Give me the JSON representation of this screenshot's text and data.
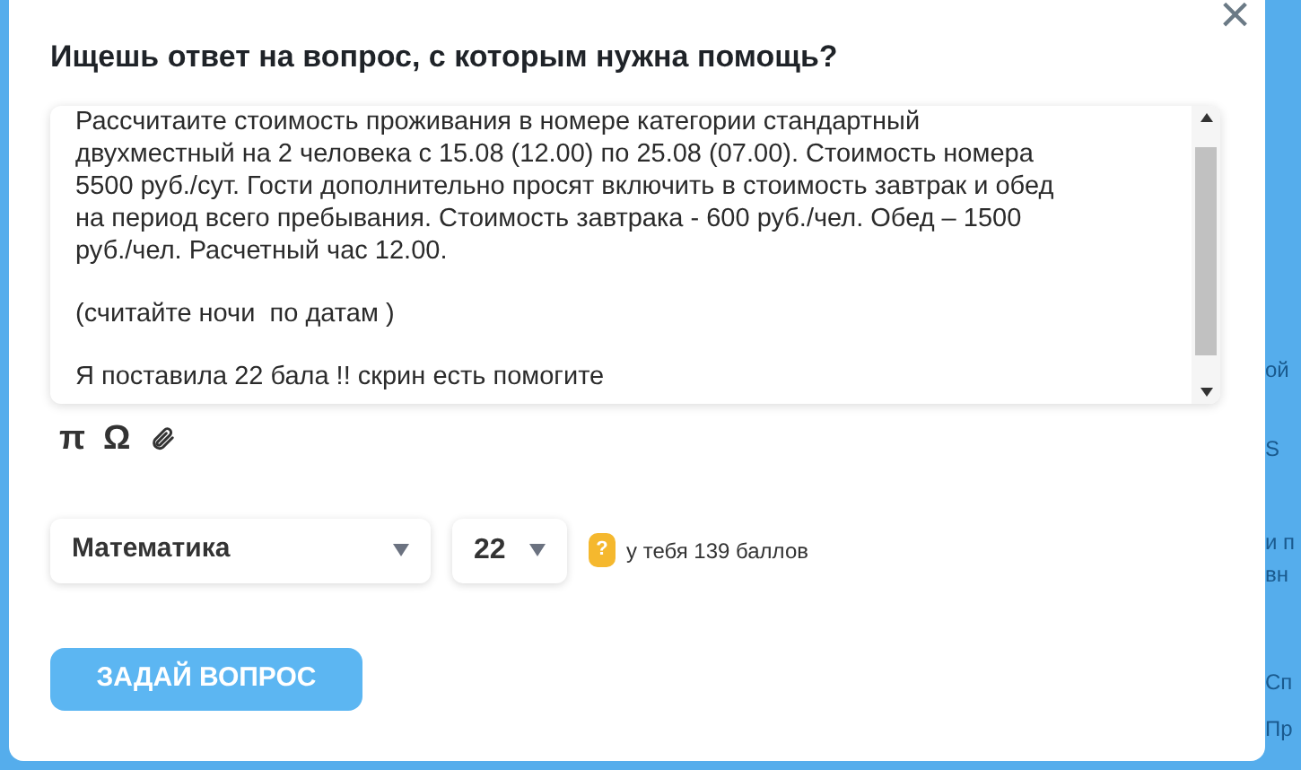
{
  "dialog": {
    "title": "Ищешь ответ на вопрос, с которым нужна помощь?",
    "close": "×"
  },
  "question_field": {
    "paragraphs": [
      [
        "Рассчитаите стоимость проживания в номере категории стандартный",
        "двухместный на 2 человека с 15.08 (12.00) по 25.08 (07.00). Стоимость номера",
        "5500 руб./сут. Гости дополнительно просят включить в стоимость завтрак и обед",
        "на период всего пребывания. Стоимость завтрака - 600 руб./чел. Обед – 1500",
        "руб./чел. Расчетный час 12.00."
      ],
      [
        "(считайте ночи  по датам )"
      ],
      [
        "Я поставила 22 бала !! скрин есть помогите"
      ]
    ]
  },
  "editor_tools": [
    {
      "kind": "char",
      "label": "π"
    },
    {
      "kind": "char",
      "label": "Ω"
    },
    {
      "kind": "attach"
    }
  ],
  "subject_select": {
    "value": "Математика"
  },
  "points_select": {
    "value": "22"
  },
  "balance": {
    "badge": "?",
    "text": "у тебя 139 баллов"
  },
  "submit_button": "ЗАДАЙ ВОПРОС",
  "background_fragments": [
    "ой",
    "S",
    "и п",
    "вн",
    "Сп",
    "Пр"
  ]
}
